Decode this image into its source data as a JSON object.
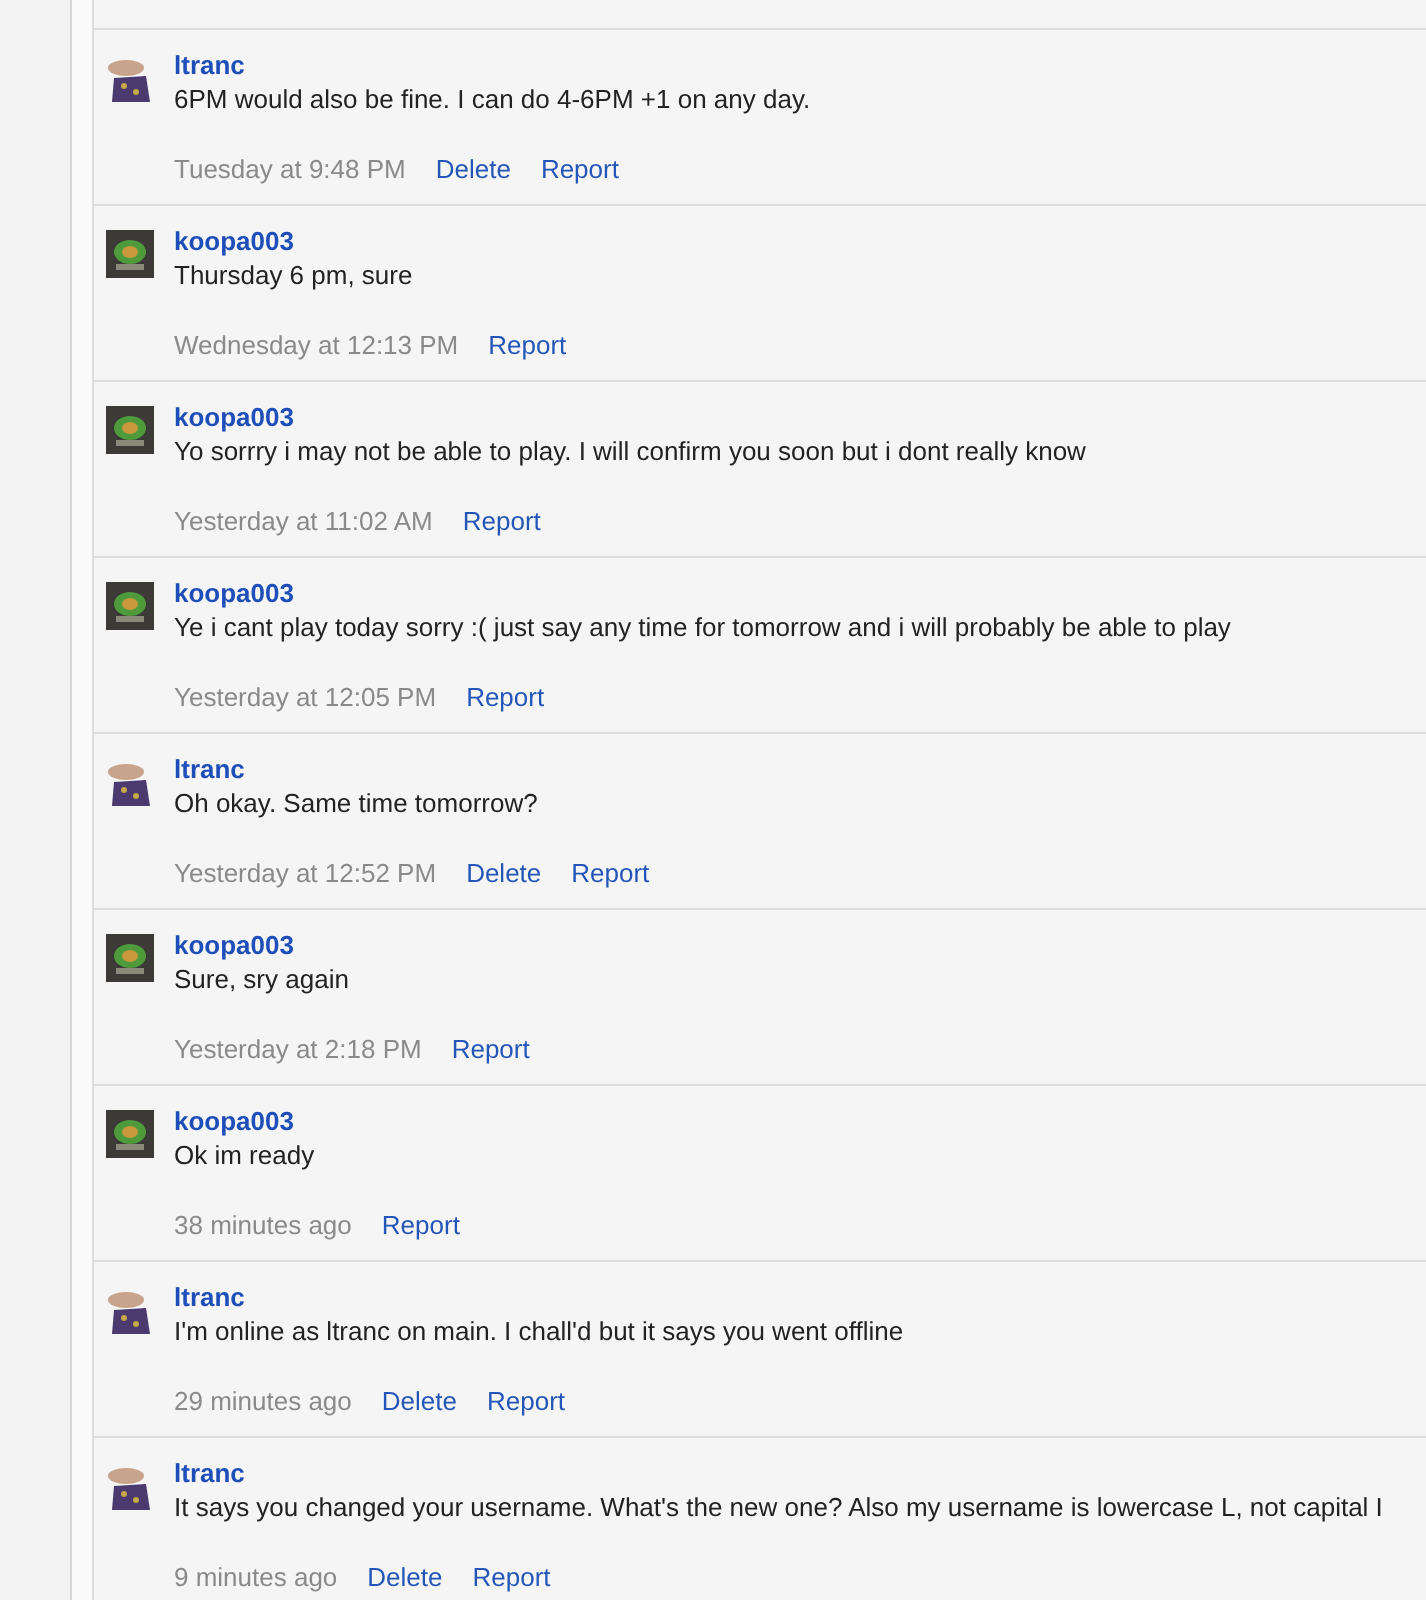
{
  "messages": [
    {
      "author": "ltranc",
      "kind": "hand",
      "text": "6PM would also be fine. I can do 4-6PM +1 on any day.",
      "time": "Tuesday at 9:48 PM",
      "actions": [
        "Delete",
        "Report"
      ]
    },
    {
      "author": "koopa003",
      "kind": "turtle",
      "text": "Thursday 6 pm, sure",
      "time": "Wednesday at 12:13 PM",
      "actions": [
        "Report"
      ]
    },
    {
      "author": "koopa003",
      "kind": "turtle",
      "text": "Yo sorrry i may not be able to play. I will confirm you soon but i dont really know",
      "time": "Yesterday at 11:02 AM",
      "actions": [
        "Report"
      ]
    },
    {
      "author": "koopa003",
      "kind": "turtle",
      "text": "Ye i cant play today sorry :( just say any time for tomorrow and i will probably be able to play",
      "time": "Yesterday at 12:05 PM",
      "actions": [
        "Report"
      ]
    },
    {
      "author": "ltranc",
      "kind": "hand",
      "text": "Oh okay. Same time tomorrow?",
      "time": "Yesterday at 12:52 PM",
      "actions": [
        "Delete",
        "Report"
      ]
    },
    {
      "author": "koopa003",
      "kind": "turtle",
      "text": "Sure, sry again",
      "time": "Yesterday at 2:18 PM",
      "actions": [
        "Report"
      ]
    },
    {
      "author": "koopa003",
      "kind": "turtle",
      "text": "Ok im ready",
      "time": "38 minutes ago",
      "actions": [
        "Report"
      ]
    },
    {
      "author": "ltranc",
      "kind": "hand",
      "text": "I'm online as ltranc on main. I chall'd but it says you went offline",
      "time": "29 minutes ago",
      "actions": [
        "Delete",
        "Report"
      ]
    },
    {
      "author": "ltranc",
      "kind": "hand",
      "text": "It says you changed your username. What's the new one? Also my username is lowercase L, not capital I",
      "time": "9 minutes ago",
      "actions": [
        "Delete",
        "Report"
      ]
    }
  ]
}
